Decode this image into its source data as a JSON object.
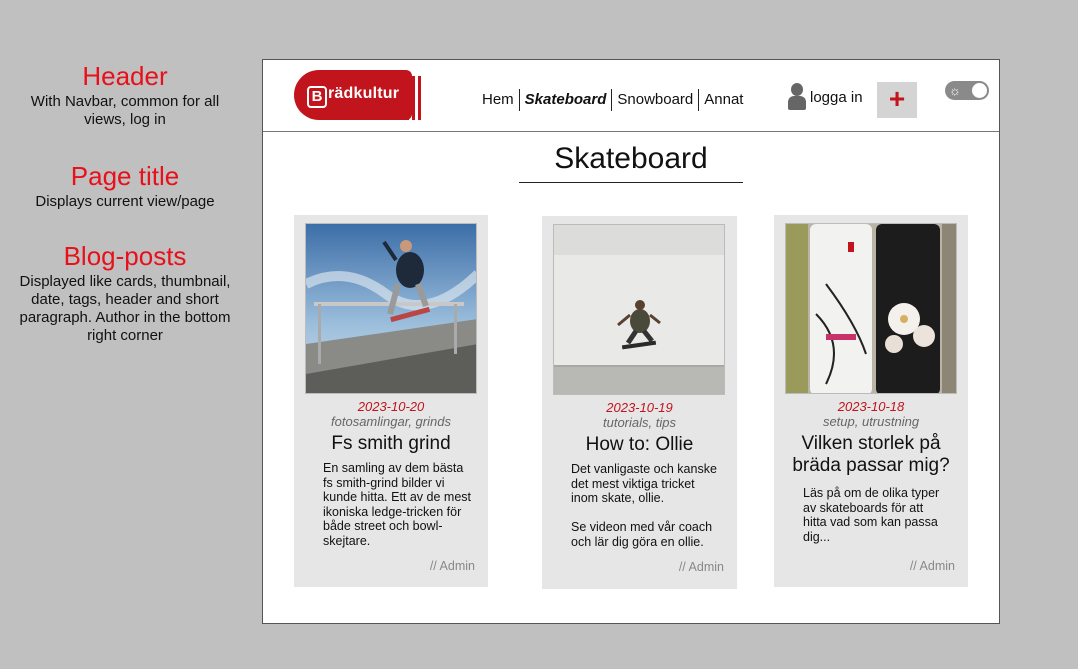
{
  "annotations": [
    {
      "title": "Header",
      "text": "With Navbar, common for all views, log in"
    },
    {
      "title": "Page title",
      "text": "Displays current view/page"
    },
    {
      "title": "Blog-posts",
      "text": "Displayed like cards, thumbnail, date, tags, header and short paragraph. Author in the bottom right corner"
    }
  ],
  "header": {
    "logo_letter": "B",
    "logo_text": "rädkultur",
    "nav": [
      "Hem",
      "Skateboard",
      "Snowboard",
      "Annat"
    ],
    "login_label": "logga in",
    "add_label": "+",
    "theme_toggle_icon": "sun-icon"
  },
  "page_title": "Skateboard",
  "posts": [
    {
      "date": "2023-10-20",
      "tags": "fotosamlingar, grinds",
      "title": "Fs smith grind",
      "excerpt": "En samling av dem bästa fs smith-grind bilder vi kunde hitta. Ett av de mest ikoniska ledge-tricken för både street och bowl-skejtare.",
      "author": "// Admin"
    },
    {
      "date": "2023-10-19",
      "tags": "tutorials, tips",
      "title": "How to: Ollie",
      "excerpt": "Det vanligaste och kanske det mest viktiga tricket inom skate, ollie.\n\nSe videon med vår coach och lär dig göra en ollie.",
      "author": "// Admin"
    },
    {
      "date": "2023-10-18",
      "tags": "setup, utrustning",
      "title": "Vilken storlek på bräda passar mig?",
      "excerpt": "Läs på om de olika typer av skateboards för att hitta vad som kan passa dig...",
      "author": "// Admin"
    }
  ],
  "colors": {
    "brand": "#c1141c",
    "annotation": "#e8101b",
    "card_bg": "#e6e6e6"
  }
}
